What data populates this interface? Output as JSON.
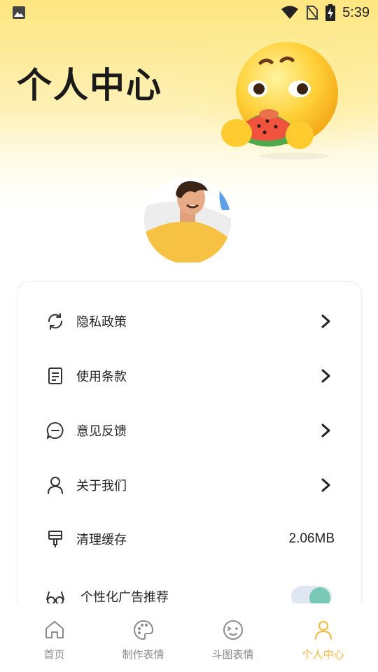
{
  "status_bar": {
    "time": "5:39"
  },
  "header": {
    "title": "个人中心"
  },
  "menu": {
    "privacy": {
      "label": "隐私政策",
      "icon": "refresh-icon"
    },
    "terms": {
      "label": "使用条款",
      "icon": "document-icon"
    },
    "feedback": {
      "label": "意见反馈",
      "icon": "chat-icon"
    },
    "about": {
      "label": "关于我们",
      "icon": "person-icon"
    },
    "cache": {
      "label": "清理缓存",
      "value": "2.06MB",
      "icon": "brush-icon"
    },
    "ads": {
      "label": "个性化广告推荐",
      "icon": "glasses-icon",
      "toggle_on": true
    }
  },
  "tabs": [
    {
      "label": "首页",
      "icon": "home-icon",
      "active": false
    },
    {
      "label": "制作表情",
      "icon": "palette-icon",
      "active": false
    },
    {
      "label": "斗图表情",
      "icon": "wink-face-icon",
      "active": false
    },
    {
      "label": "个人中心",
      "icon": "person-icon",
      "active": true
    }
  ],
  "colors": {
    "accent": "#f5b83c",
    "toggle_knob": "#79c9b5",
    "toggle_track": "#dfe7f3"
  }
}
